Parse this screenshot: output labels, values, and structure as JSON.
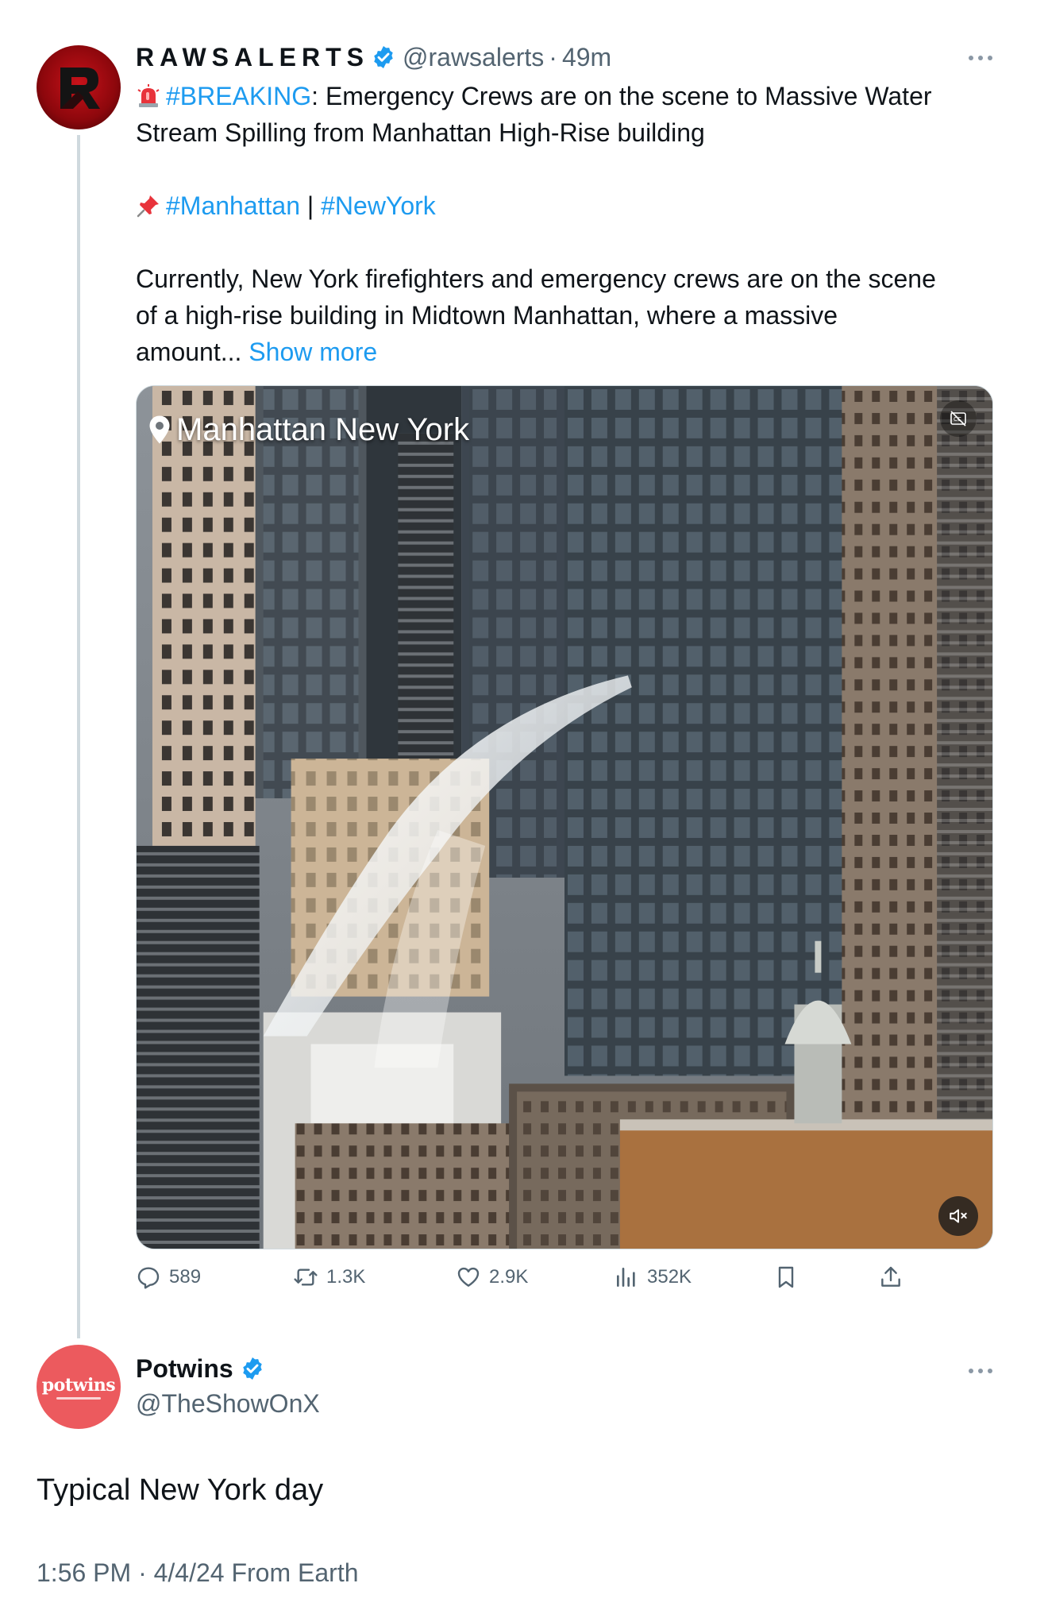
{
  "thread": {
    "line_color": "#cfd9de"
  },
  "tweet1": {
    "avatar_icon": "rawsalerts-logo",
    "display_name": "RAWSALERTS",
    "verified_icon": "verified-badge-icon",
    "handle": "@rawsalerts",
    "separator": "·",
    "time": "49m",
    "line1_emoji": "rotating-light-emoji",
    "line1_hashtag": "#BREAKING",
    "line1_text": ": Emergency Crews are on the scene to Massive Water",
    "line2_text": "Stream Spilling from Manhattan High-Rise building",
    "line3_emoji": "pushpin-emoji",
    "line3_hashtag1": "#Manhattan",
    "line3_sep": " | ",
    "line3_hashtag2": "#NewYork",
    "para_line1": "Currently, New York firefighters and emergency crews are on the scene",
    "para_line2": "of a high-rise building in Midtown Manhattan, where a massive",
    "para_line3": "amount... ",
    "show_more": "Show more",
    "media": {
      "location_overlay": "Manhattan New York",
      "cc_icon": "captions-off-icon",
      "mute_icon": "muted-speaker-icon"
    },
    "actions": {
      "replies": "589",
      "reposts": "1.3K",
      "likes": "2.9K",
      "views": "352K"
    }
  },
  "tweet2": {
    "avatar_text": "potwins",
    "display_name": "Potwins",
    "handle": "@TheShowOnX",
    "text": "Typical New York day",
    "meta": "1:56 PM · 4/4/24 From Earth"
  },
  "colors": {
    "link": "#1d9bf0",
    "secondary_text": "#536471",
    "verified": "#1d9bf0",
    "potwins_avatar": "#ec5a5e",
    "rawsalerts_avatar": "#c8121a"
  }
}
